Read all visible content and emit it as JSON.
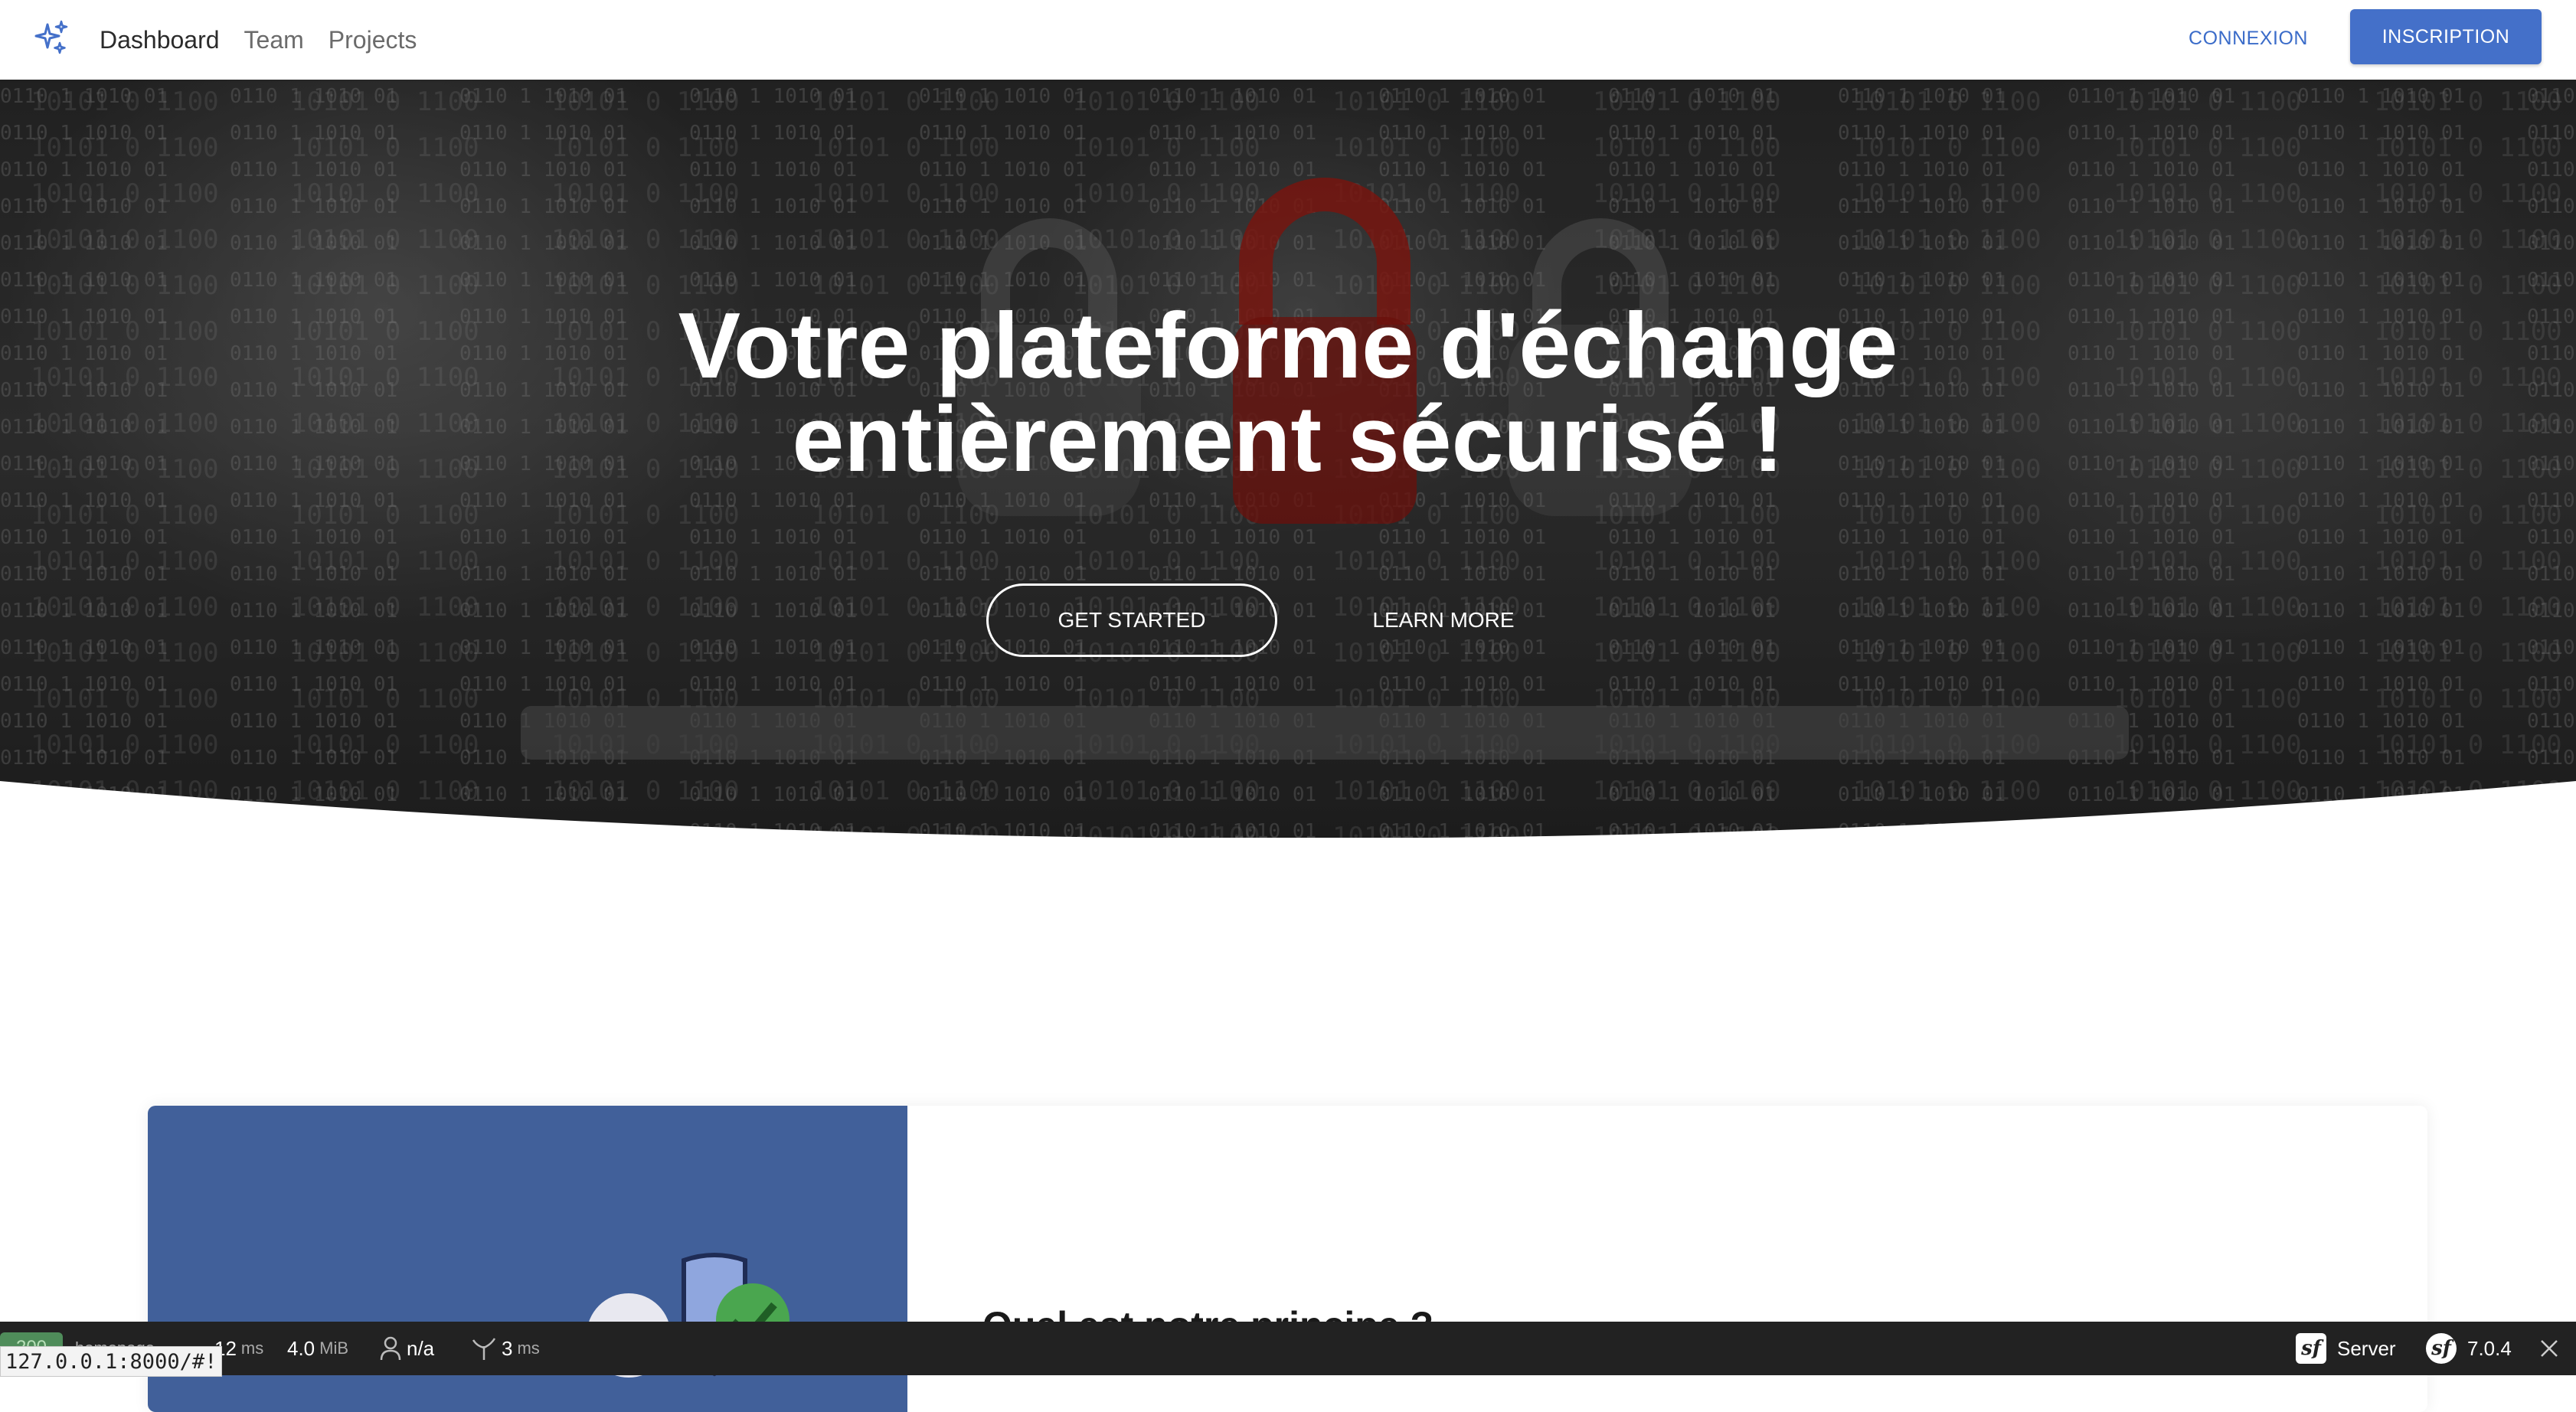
{
  "nav": {
    "links": [
      {
        "label": "Dashboard"
      },
      {
        "label": "Team"
      },
      {
        "label": "Projects"
      }
    ],
    "login_label": "CONNEXION",
    "signup_label": "INSCRIPTION"
  },
  "hero": {
    "title_line1": "Votre plateforme d'échange",
    "title_line2": "entièrement sécurisé !",
    "primary_button": "GET STARTED",
    "secondary_button": "LEARN MORE"
  },
  "feature": {
    "title": "Quel est notre principe ?"
  },
  "debug_toolbar": {
    "status_code": "200",
    "route": "homepage",
    "time_value": "12",
    "time_unit": "ms",
    "memory_value": "4.0",
    "memory_unit": "MiB",
    "user": "n/a",
    "twig_value": "3",
    "twig_unit": "ms",
    "server_label": "Server",
    "version": "7.0.4"
  },
  "status_url": "127.0.0.1:8000/#!",
  "colors": {
    "brand_blue": "#4470c9",
    "card_blue": "#41609a",
    "toolbar_bg": "#222222"
  }
}
